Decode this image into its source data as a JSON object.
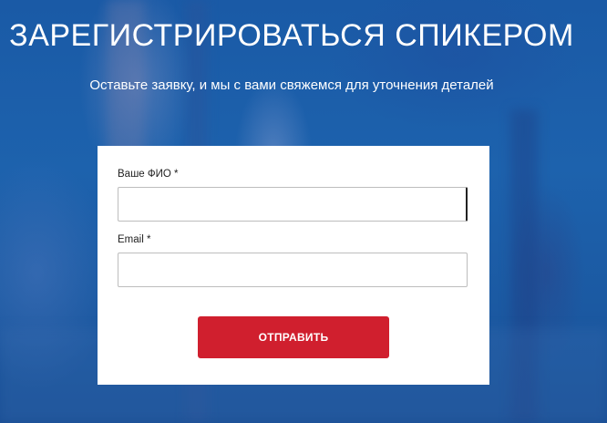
{
  "header": {
    "title": "ЗАРЕГИСТРИРОВАТЬСЯ СПИКЕРОМ",
    "subtitle": "Оставьте заявку, и мы с вами свяжемся для уточнения деталей"
  },
  "form": {
    "name_label": "Ваше ФИО *",
    "name_value": "",
    "email_label": "Email *",
    "email_value": "",
    "submit_label": "ОТПРАВИТЬ"
  },
  "colors": {
    "background": "#1d5aa0",
    "accent": "#d01f2e",
    "card": "#ffffff"
  }
}
